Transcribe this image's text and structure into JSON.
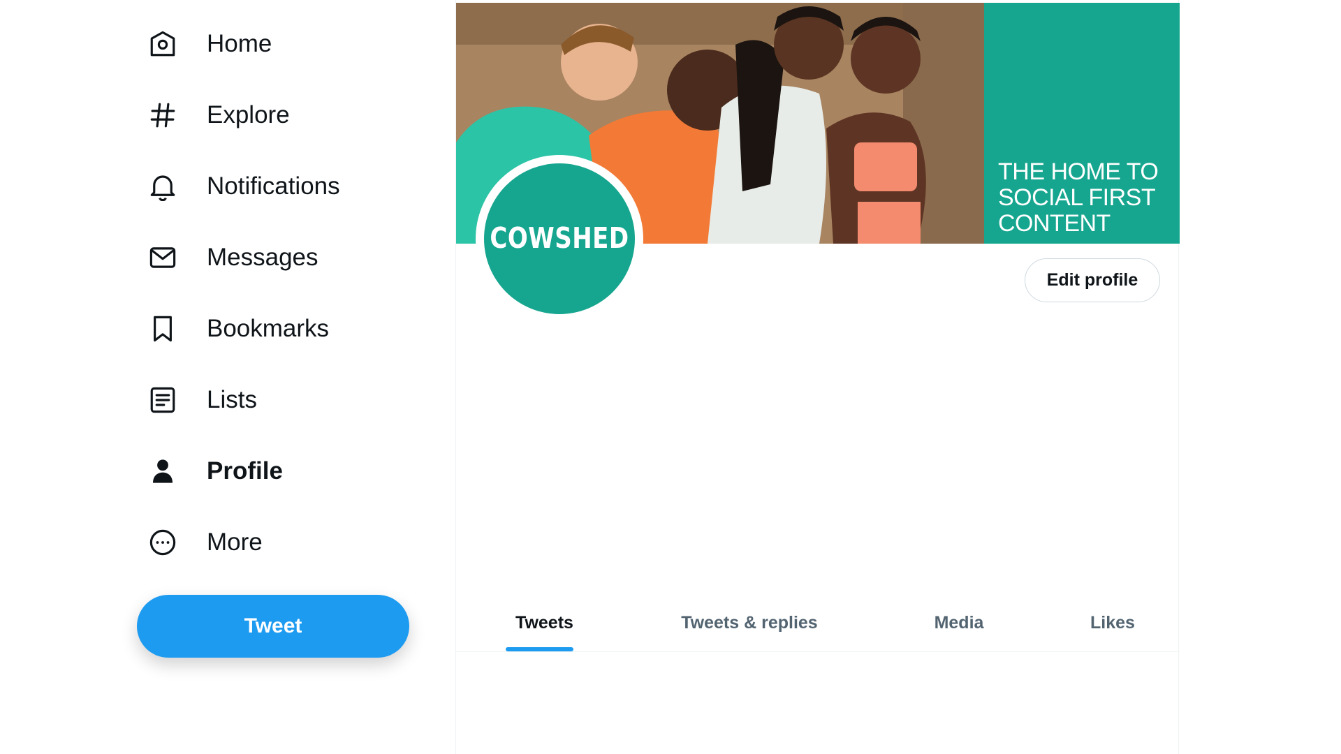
{
  "sidebar": {
    "items": [
      {
        "label": "Home",
        "icon": "home-icon"
      },
      {
        "label": "Explore",
        "icon": "hashtag-icon"
      },
      {
        "label": "Notifications",
        "icon": "bell-icon"
      },
      {
        "label": "Messages",
        "icon": "envelope-icon"
      },
      {
        "label": "Bookmarks",
        "icon": "bookmark-icon"
      },
      {
        "label": "Lists",
        "icon": "list-icon"
      },
      {
        "label": "Profile",
        "icon": "person-icon",
        "active": true
      },
      {
        "label": "More",
        "icon": "more-circle-icon"
      }
    ],
    "tweet_label": "Tweet"
  },
  "profile": {
    "banner_tagline": "THE HOME TO SOCIAL FIRST CONTENT",
    "avatar_text": "COWSHED",
    "edit_profile_label": "Edit profile"
  },
  "tabs": [
    {
      "label": "Tweets",
      "active": true
    },
    {
      "label": "Tweets & replies"
    },
    {
      "label": "Media"
    },
    {
      "label": "Likes"
    }
  ],
  "colors": {
    "accent": "#1d9bf0",
    "brand_green": "#16a68f",
    "text_primary": "#0f1419",
    "text_secondary": "#536471"
  }
}
